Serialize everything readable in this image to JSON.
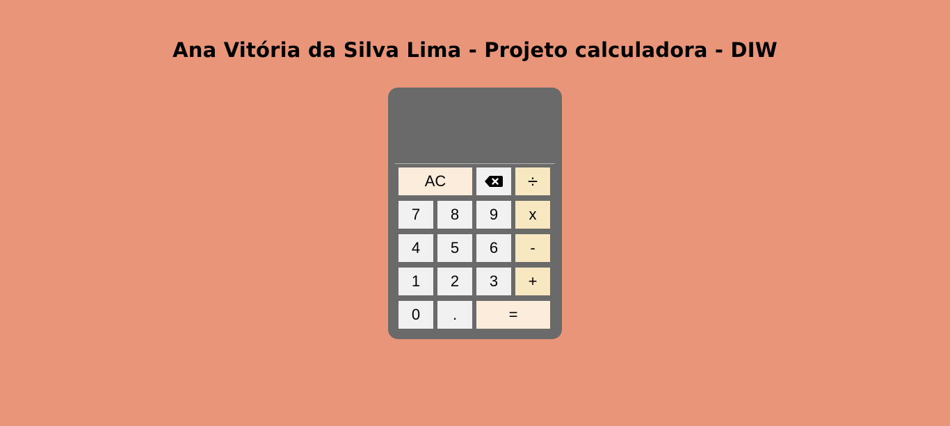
{
  "page": {
    "title": "Ana Vitória da Silva Lima - Projeto calculadora - DIW"
  },
  "calculator": {
    "display_value": "",
    "keys": {
      "ac": "AC",
      "divide": "÷",
      "seven": "7",
      "eight": "8",
      "nine": "9",
      "multiply": "x",
      "four": "4",
      "five": "5",
      "six": "6",
      "minus": "-",
      "one": "1",
      "two": "2",
      "three": "3",
      "plus": "+",
      "zero": "0",
      "dot": ".",
      "equals": "="
    },
    "backspace_icon": "backspace-icon"
  },
  "colors": {
    "background": "#e9957a",
    "calculator_body": "#6a6a6a",
    "number_key": "#f1f1f1",
    "operator_key": "#f8e8c1",
    "action_key": "#fbecdc"
  }
}
